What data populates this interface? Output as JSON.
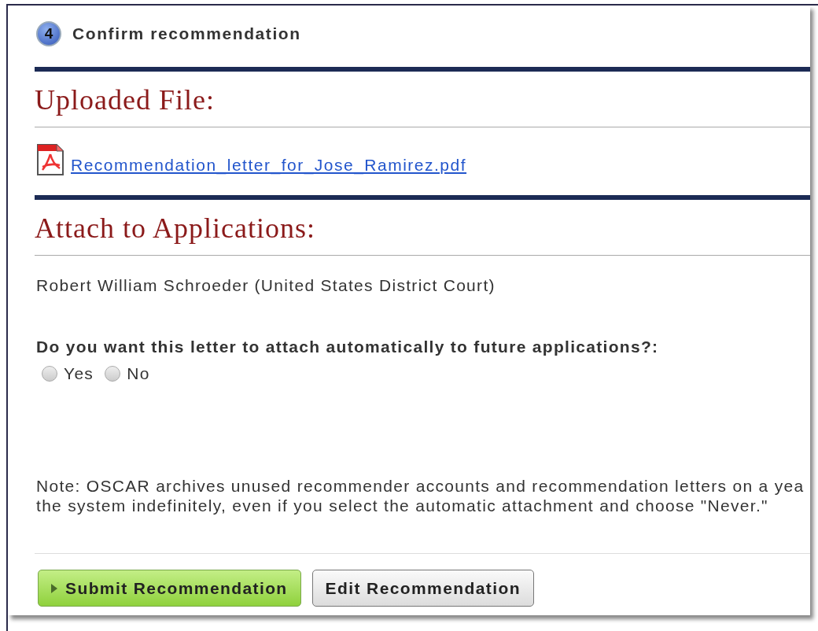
{
  "step": {
    "number": "4",
    "title": "Confirm recommendation"
  },
  "uploaded_section": {
    "heading": "Uploaded File:",
    "file_link": "Recommendation_letter_for_Jose_Ramirez.pdf"
  },
  "attach_section": {
    "heading": "Attach to Applications:",
    "application": "Robert William Schroeder (United States District Court)",
    "question": "Do you want this letter to attach automatically to future applications?:",
    "options": [
      {
        "label": "Yes",
        "selected": false
      },
      {
        "label": "No",
        "selected": false
      }
    ]
  },
  "note_lines": [
    "Note: OSCAR archives unused recommender accounts and recommendation letters on a yea",
    "the system indefinitely, even if you select the automatic attachment and choose \"Never.\""
  ],
  "buttons": [
    {
      "label": "Submit Recommendation",
      "kind": "primary"
    },
    {
      "label": "Edit Recommendation",
      "kind": "secondary"
    }
  ]
}
